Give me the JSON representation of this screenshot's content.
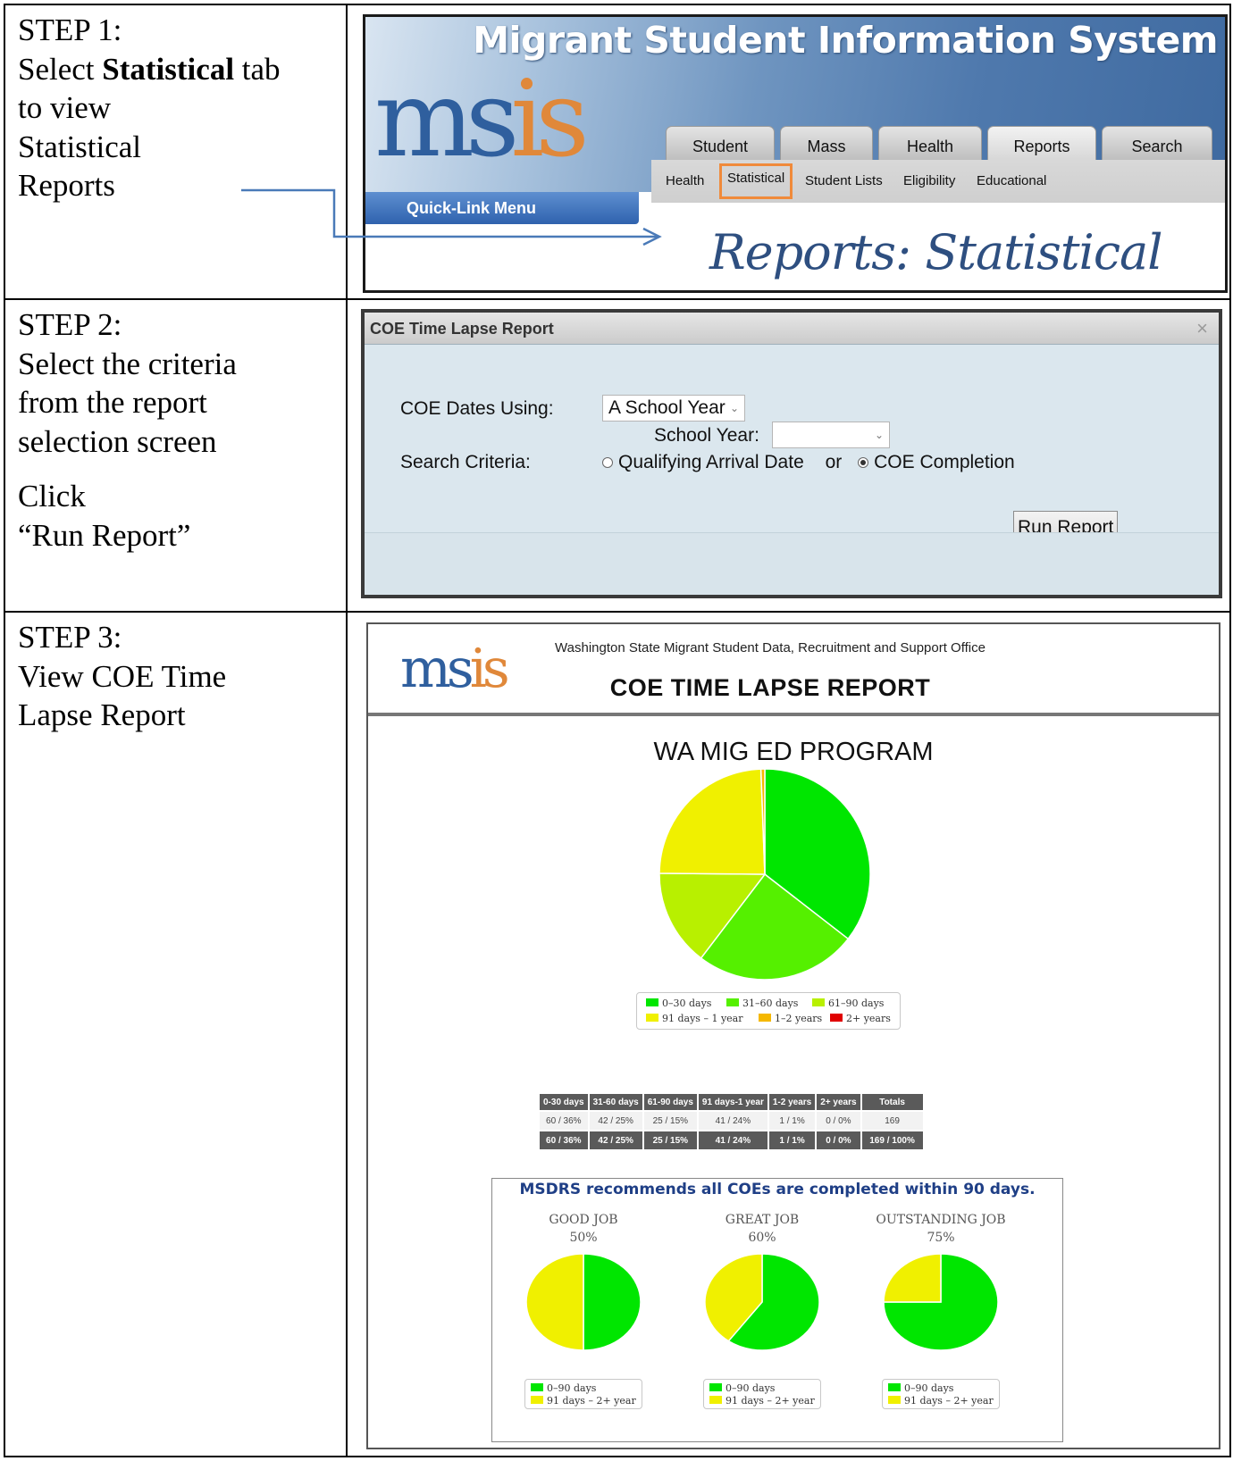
{
  "steps": [
    {
      "label": "STEP 1:",
      "lines": [
        "Select ",
        "Statistical",
        " tab",
        "to view",
        "Statistical",
        "Reports"
      ]
    },
    {
      "label": "STEP 2:",
      "lines": [
        "Select the criteria",
        "from the report",
        "selection screen",
        "Click",
        "“Run Report”"
      ]
    },
    {
      "label": "STEP 3:",
      "lines": [
        "View COE Time",
        "Lapse Report"
      ]
    }
  ],
  "msis": {
    "title": "Migrant Student Information System",
    "logo": "msis",
    "tabs": [
      "Student",
      "Mass",
      "Health",
      "Reports",
      "Search"
    ],
    "active_tab": "Reports",
    "subtabs": [
      "Health",
      "Statistical",
      "Student Lists",
      "Eligibility",
      "Educational"
    ],
    "selected_subtab": "Statistical",
    "quick_link": "Quick-Link Menu",
    "page_heading": "Reports: Statistical",
    "arrow_color": "#4a7ab8",
    "highlight_color": "#f08a3a"
  },
  "dialog": {
    "title": "COE Time Lapse Report",
    "close": "×",
    "coe_dates_label": "COE Dates Using:",
    "coe_dates_value": "A School Year",
    "school_year_label": "School Year:",
    "school_year_value": "",
    "search_criteria_label": "Search Criteria:",
    "option_qualifying": "Qualifying Arrival Date",
    "or_text": "or",
    "option_coe": "COE Completion",
    "selected_option": "COE Completion",
    "run_button": "Run Report"
  },
  "report": {
    "logo": "msis",
    "office": "Washington State Migrant Student Data, Recruitment and Support Office",
    "title": "COE TIME LAPSE REPORT",
    "chart_title": "WA MIG ED PROGRAM",
    "legend": [
      {
        "label": "0–30 days",
        "color": "#00e600"
      },
      {
        "label": "31–60 days",
        "color": "#55f000"
      },
      {
        "label": "61–90 days",
        "color": "#b8f000"
      },
      {
        "label": "91 days – 1 year",
        "color": "#f0f000"
      },
      {
        "label": "1–2 years",
        "color": "#f5b800"
      },
      {
        "label": "2+ years",
        "color": "#e00000"
      }
    ],
    "table": {
      "headers": [
        "0-30 days",
        "31-60 days",
        "61-90 days",
        "91 days-1 year",
        "1-2 years",
        "2+ years",
        "Totals"
      ],
      "rows": [
        [
          "60 / 36%",
          "42 / 25%",
          "25 / 15%",
          "41 / 24%",
          "1 / 1%",
          "0 / 0%",
          "169"
        ]
      ],
      "totals": [
        "60 / 36%",
        "42 / 25%",
        "25 / 15%",
        "41 / 24%",
        "1 / 1%",
        "0 / 0%",
        "169 / 100%"
      ]
    },
    "recommendation": "MSDRS recommends all COEs are completed within 90 days.",
    "grades": [
      {
        "name": "GOOD JOB",
        "pct": "50%",
        "value": 50
      },
      {
        "name": "GREAT JOB",
        "pct": "60%",
        "value": 60
      },
      {
        "name": "OUTSTANDING JOB",
        "pct": "75%",
        "value": 75
      }
    ],
    "small_legend": [
      {
        "label": "0–90 days",
        "color": "#00e600"
      },
      {
        "label": "91 days – 2+ year",
        "color": "#f0f000"
      }
    ]
  },
  "chart_data": [
    {
      "type": "pie",
      "title": "WA MIG ED PROGRAM",
      "categories": [
        "0-30 days",
        "31-60 days",
        "61-90 days",
        "91 days - 1 year",
        "1-2 years",
        "2+ years"
      ],
      "values": [
        60,
        42,
        25,
        41,
        1,
        0
      ],
      "colors": [
        "#00e600",
        "#55f000",
        "#b8f000",
        "#f0f000",
        "#f5b800",
        "#e00000"
      ]
    },
    {
      "type": "pie",
      "title": "GOOD JOB",
      "categories": [
        "0-90 days",
        "91 days - 2+ year"
      ],
      "values": [
        50,
        50
      ],
      "colors": [
        "#00e600",
        "#f0f000"
      ]
    },
    {
      "type": "pie",
      "title": "GREAT JOB",
      "categories": [
        "0-90 days",
        "91 days - 2+ year"
      ],
      "values": [
        60,
        40
      ],
      "colors": [
        "#00e600",
        "#f0f000"
      ]
    },
    {
      "type": "pie",
      "title": "OUTSTANDING JOB",
      "categories": [
        "0-90 days",
        "91 days - 2+ year"
      ],
      "values": [
        75,
        25
      ],
      "colors": [
        "#00e600",
        "#f0f000"
      ]
    }
  ]
}
